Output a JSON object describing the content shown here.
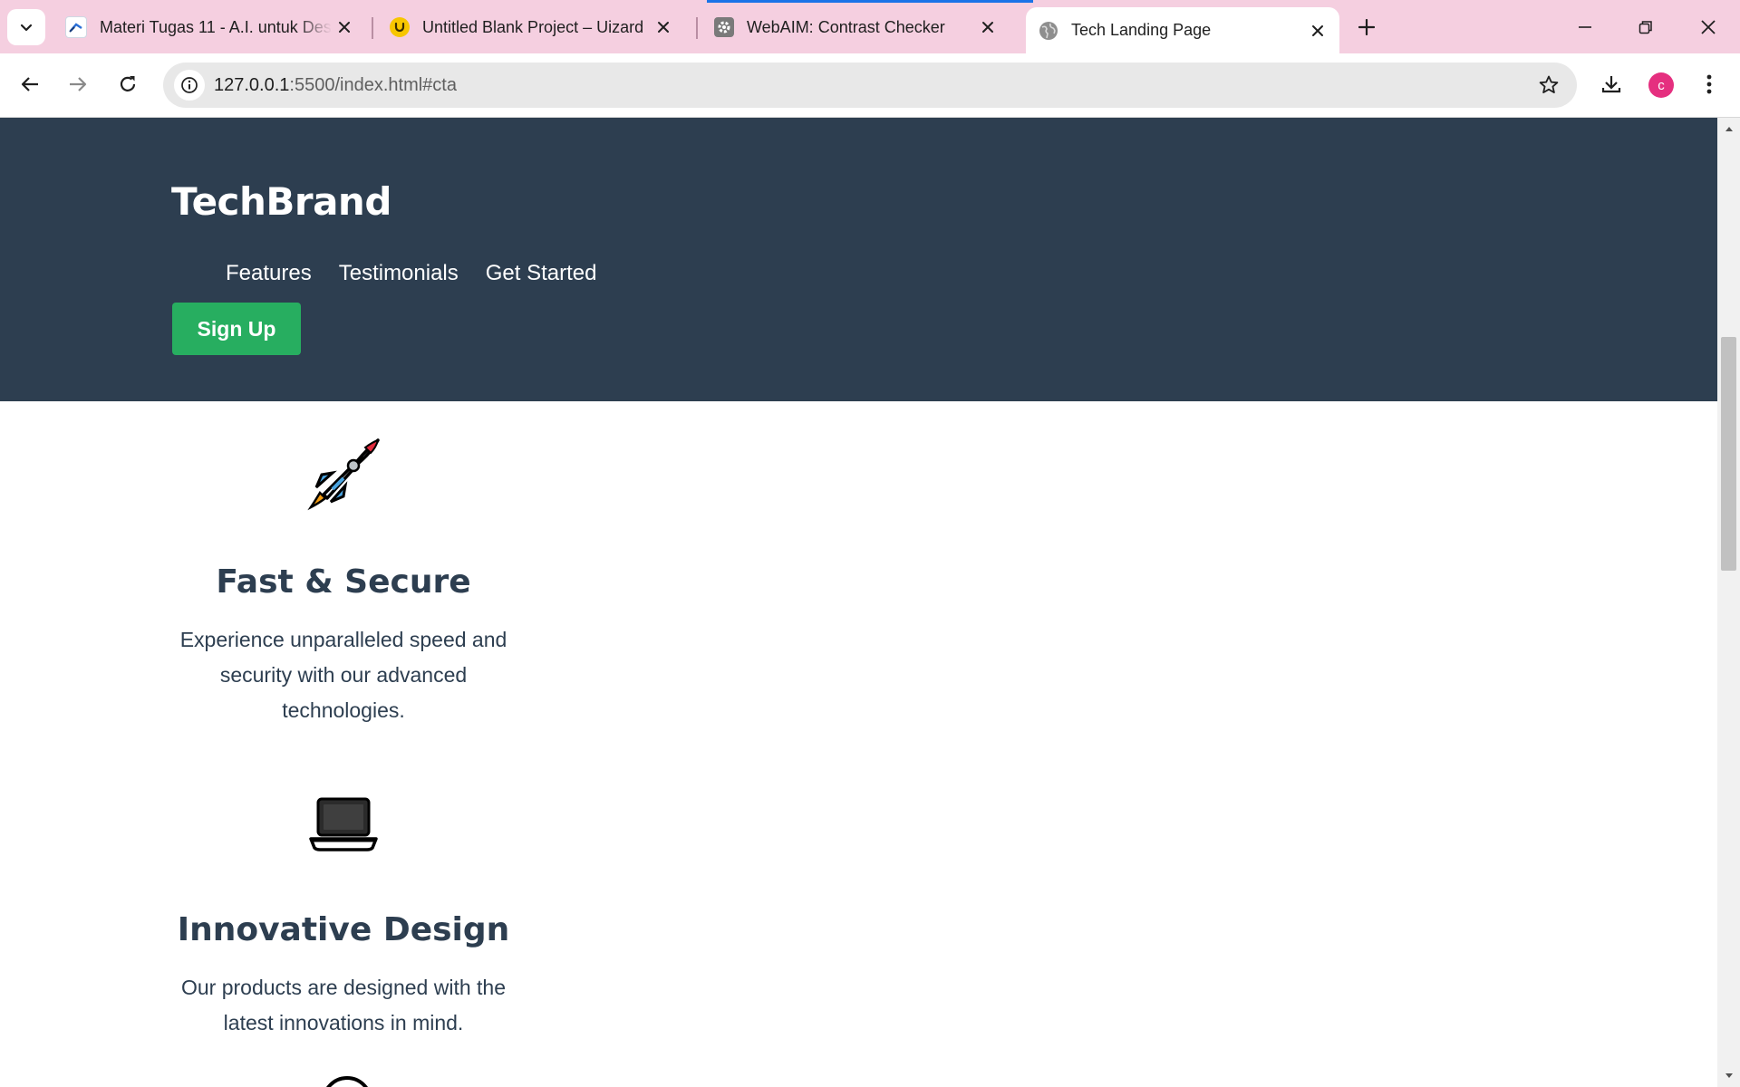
{
  "browser": {
    "tabs": [
      {
        "title": "Materi Tugas 11 - A.I. untuk Desain",
        "icon": "document-favicon-icon",
        "active": false
      },
      {
        "title": "Untitled Blank Project – Uizard",
        "icon": "uizard-favicon-icon",
        "active": false
      },
      {
        "title": "WebAIM: Contrast Checker",
        "icon": "webaim-gear-favicon-icon",
        "active": false
      },
      {
        "title": "Tech Landing Page",
        "icon": "globe-favicon-icon",
        "active": true
      }
    ],
    "url_host": "127.0.0.1",
    "url_rest": ":5500/index.html#cta",
    "profile_initial": "c",
    "colors": {
      "tabstrip": "#f5cfe0",
      "avatar": "#e52f7f"
    }
  },
  "page": {
    "brand": "TechBrand",
    "nav": [
      "Features",
      "Testimonials",
      "Get Started"
    ],
    "signup_label": "Sign Up",
    "features": [
      {
        "icon": "rocket-icon",
        "title": "Fast & Secure",
        "description": "Experience unparalleled speed and security with our advanced technologies."
      },
      {
        "icon": "laptop-icon",
        "title": "Innovative Design",
        "description": "Our products are designed with the latest innovations in mind."
      }
    ],
    "colors": {
      "header_bg": "#2d3e50",
      "cta_green": "#27ae60",
      "text": "#2d3e50"
    }
  }
}
